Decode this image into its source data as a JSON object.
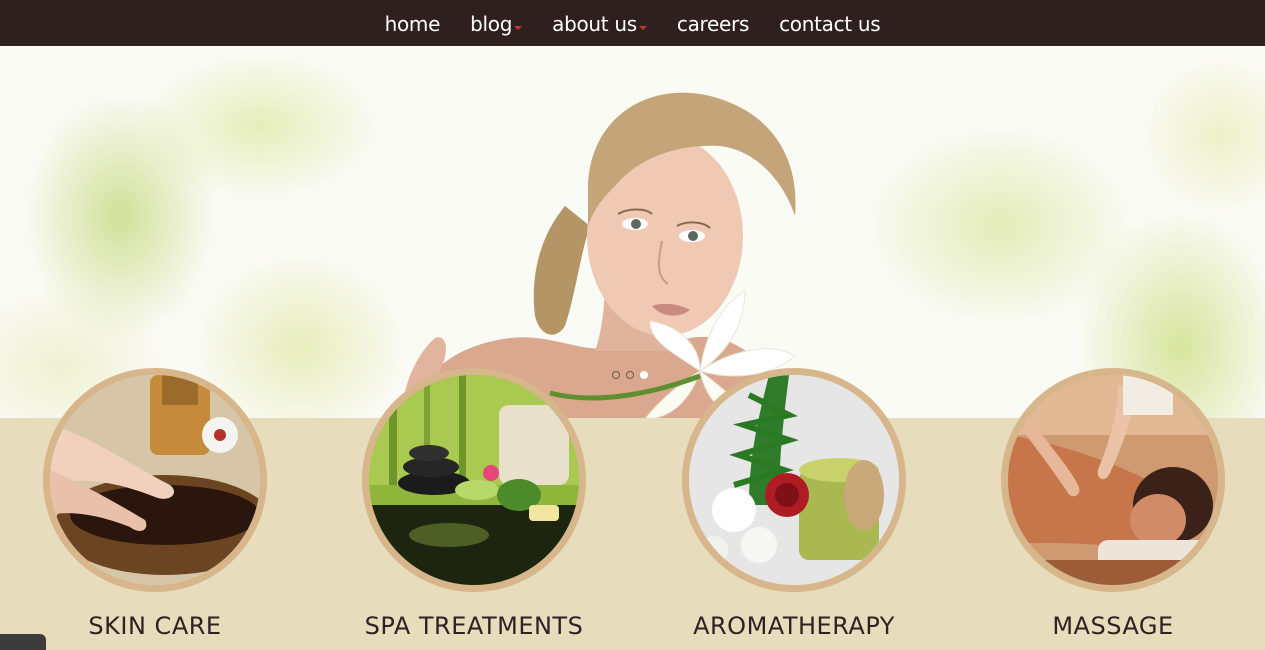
{
  "nav": {
    "items": [
      {
        "label": "home",
        "has_dropdown": false
      },
      {
        "label": "blog",
        "has_dropdown": true
      },
      {
        "label": "about us",
        "has_dropdown": true
      },
      {
        "label": "careers",
        "has_dropdown": false
      },
      {
        "label": "contact us",
        "has_dropdown": false
      }
    ]
  },
  "hero": {
    "image": "woman-with-lily-photo",
    "slider_dots": {
      "count": 3,
      "active_index": 2
    }
  },
  "services": [
    {
      "title": "SKIN CARE",
      "image": "hand-in-bowl-photo"
    },
    {
      "title": "SPA TREATMENTS",
      "image": "spa-stones-photo"
    },
    {
      "title": "AROMATHERAPY",
      "image": "flowers-and-jar-photo"
    },
    {
      "title": "MASSAGE",
      "image": "back-massage-photo"
    }
  ],
  "colors": {
    "nav_bg": "#2f1f1f",
    "nav_text": "#ffffff",
    "caret": "#c0392b",
    "section_bg": "#e7dcbb",
    "ring": "#d6b68a",
    "title_text": "#2e2222"
  }
}
